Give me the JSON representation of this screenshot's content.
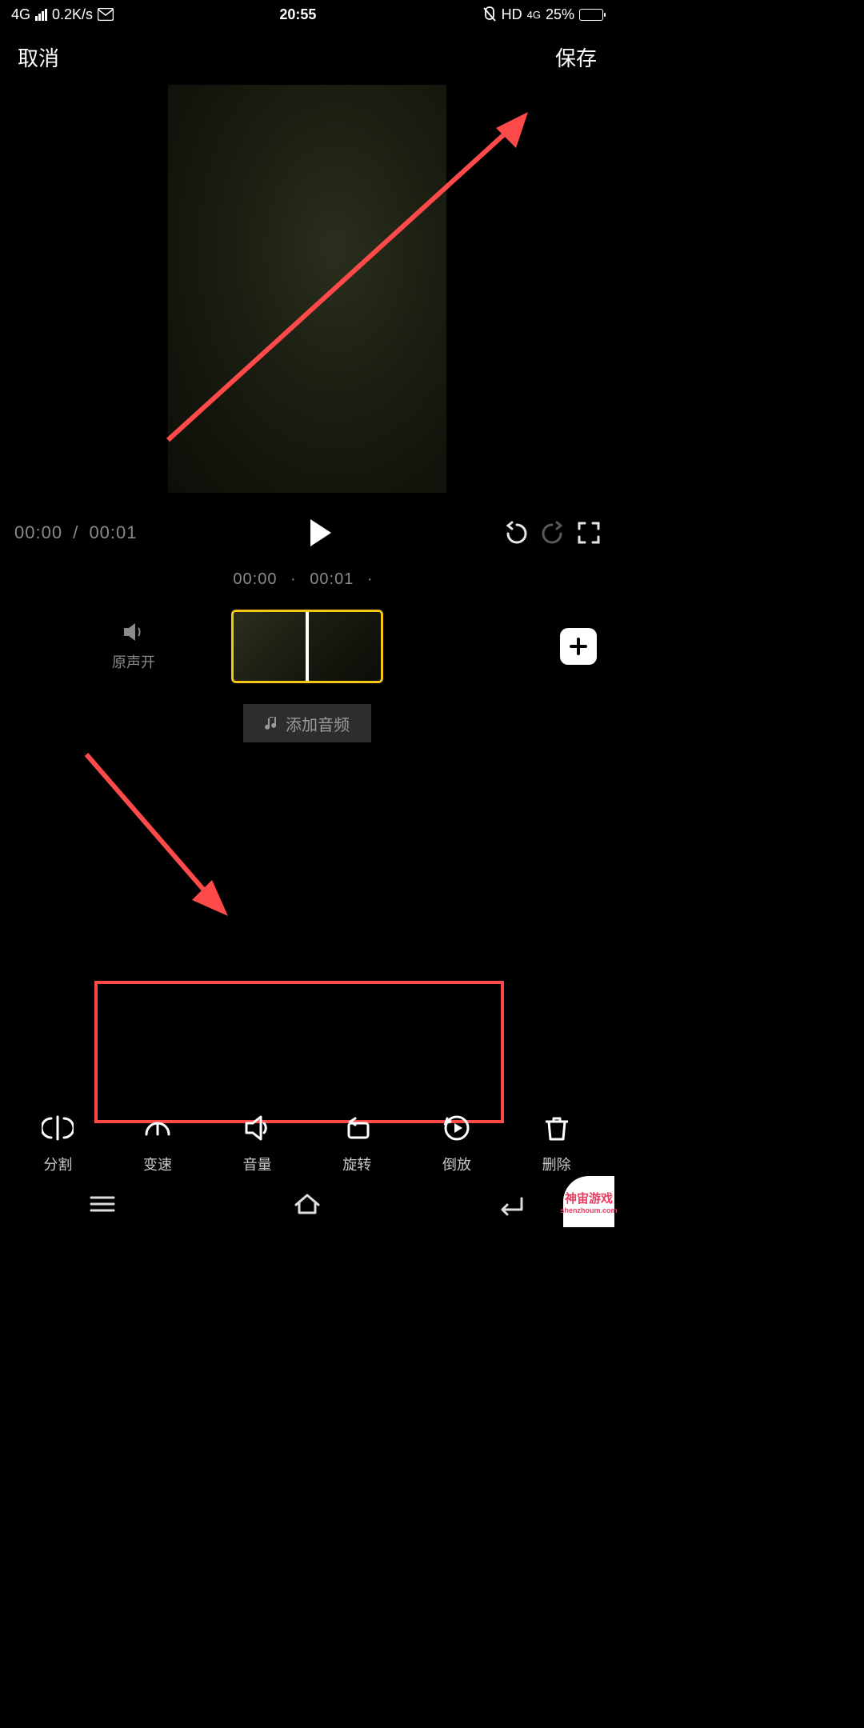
{
  "status": {
    "net": "4G",
    "speed": "0.2K/s",
    "time": "20:55",
    "hd": "HD",
    "net2": "4G",
    "battery_pct": "25%"
  },
  "header": {
    "cancel": "取消",
    "save": "保存"
  },
  "player": {
    "current": "00:00",
    "sep": "/",
    "total": "00:01"
  },
  "timeline": {
    "tick_start": "00:00",
    "tick_end": "00:01",
    "sound_label": "原声开",
    "add_audio": "添加音频"
  },
  "tools": {
    "split": "分割",
    "speed": "变速",
    "volume": "音量",
    "rotate": "旋转",
    "reverse": "倒放",
    "delete": "删除"
  },
  "watermark": {
    "line1": "神宙游戏",
    "line2": "shenzhoum.com"
  }
}
